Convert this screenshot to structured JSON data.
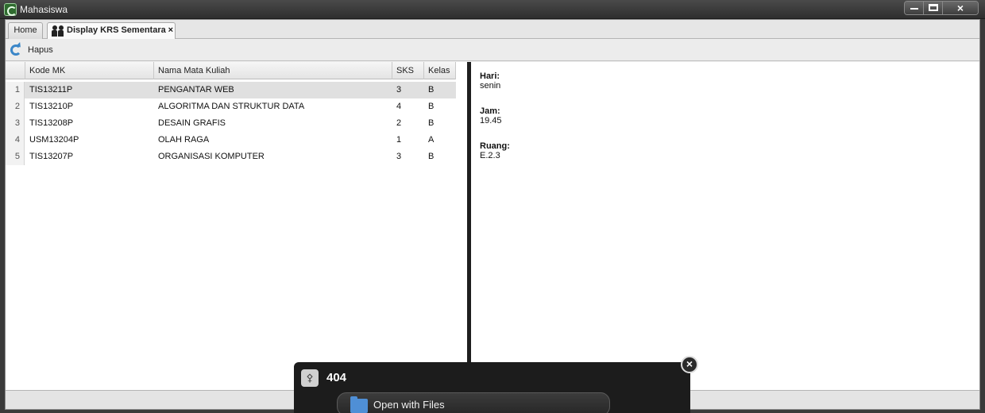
{
  "window": {
    "title": "Mahasiswa"
  },
  "tabs": [
    {
      "label": "Home"
    },
    {
      "label": "Display KRS Sementara",
      "close": "×"
    }
  ],
  "toolbar": {
    "hapus_label": "Hapus"
  },
  "table": {
    "columns": [
      "Kode MK",
      "Nama Mata Kuliah",
      "SKS",
      "Kelas"
    ],
    "rows": [
      {
        "no": "1",
        "kode": "TIS13211P",
        "nama": "PENGANTAR WEB",
        "sks": "3",
        "kelas": "B"
      },
      {
        "no": "2",
        "kode": "TIS13210P",
        "nama": "ALGORITMA DAN STRUKTUR DATA",
        "sks": "4",
        "kelas": "B"
      },
      {
        "no": "3",
        "kode": "TIS13208P",
        "nama": "DESAIN GRAFIS",
        "sks": "2",
        "kelas": "B"
      },
      {
        "no": "4",
        "kode": "USM13204P",
        "nama": "OLAH RAGA",
        "sks": "1",
        "kelas": "A"
      },
      {
        "no": "5",
        "kode": "TIS13207P",
        "nama": "ORGANISASI KOMPUTER",
        "sks": "3",
        "kelas": "B"
      }
    ],
    "selected_row": 1
  },
  "detail": {
    "hari_label": "Hari:",
    "hari_value": "senin",
    "jam_label": "Jam:",
    "jam_value": "19.45",
    "ruang_label": "Ruang:",
    "ruang_value": "E.2.3"
  },
  "notification": {
    "title": "404",
    "action_label": "Open with Files",
    "icon": "usb-icon",
    "close": "×"
  },
  "icons": {
    "app": "app-icon",
    "tab": "users-icon",
    "hapus": "refresh-icon",
    "action": "folder-icon"
  },
  "colors": {
    "titlebar": "#3a3a3a",
    "accent": "#3a86c8",
    "selected_row": "#e0e0e0"
  }
}
